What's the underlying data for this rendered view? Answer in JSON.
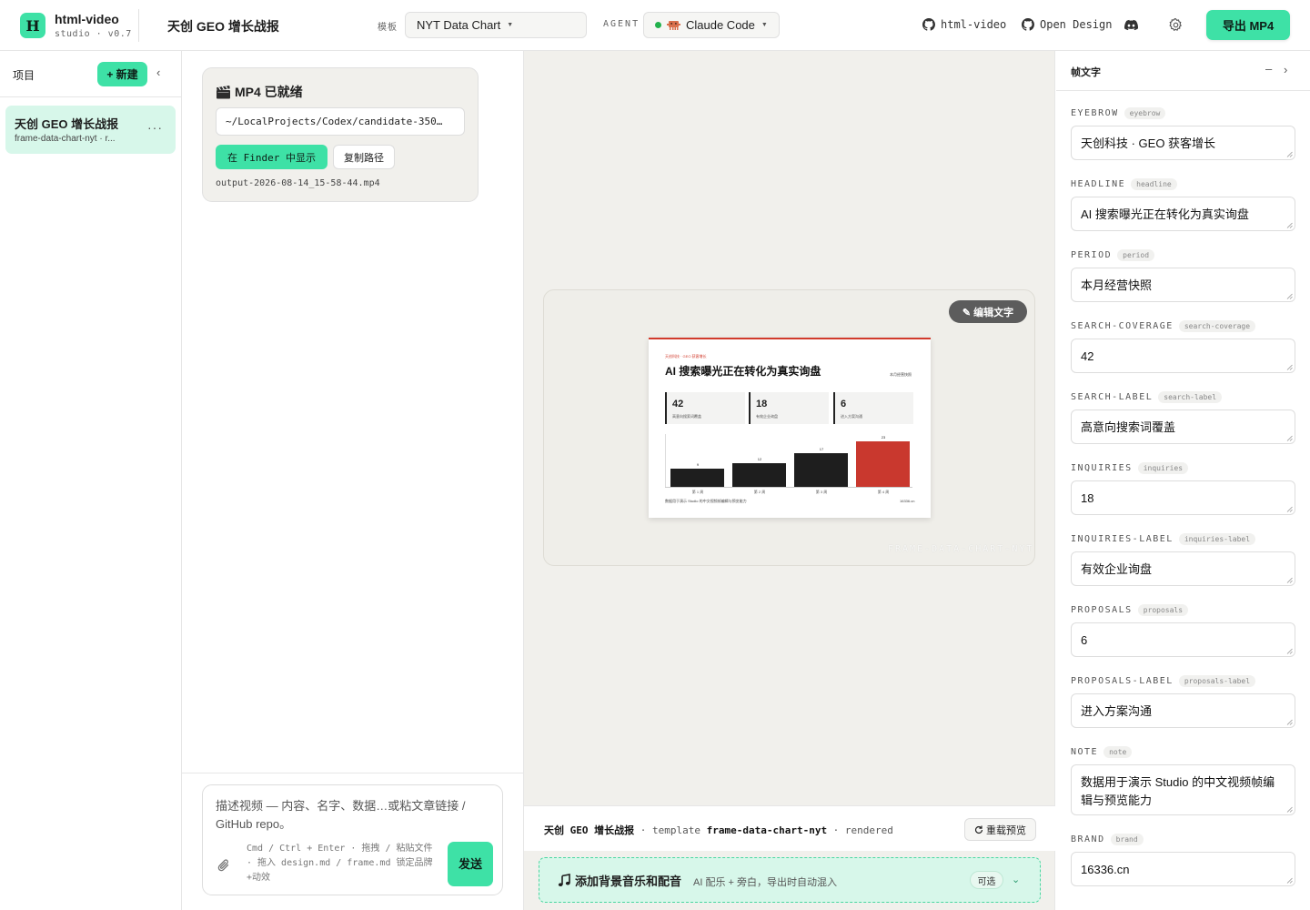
{
  "header": {
    "logo_letter": "H",
    "app_name": "html-video",
    "app_version": "studio · v0.7",
    "project_title": "天创 GEO 增长战报",
    "template_label": "模板",
    "template_value": "NYT Data Chart",
    "agent_label": "AGENT",
    "agent_value": "Claude Code",
    "link_html_video": "html-video",
    "link_open_design": "Open Design",
    "export_label": "导出 MP4",
    "accent_color": "#3ee1a6"
  },
  "sidebar": {
    "title": "项目",
    "new_label": "+ 新建",
    "collapse_glyph": "‹",
    "items": [
      {
        "name": "天创 GEO 增长战报",
        "sub": "frame-data-chart-nyt · r...",
        "more": "···"
      }
    ]
  },
  "chat": {
    "mp4_title": "MP4 已就绪",
    "output_path": "~/LocalProjects/Codex/candidate-350…",
    "finder_label": "在 Finder 中显示",
    "copy_label": "复制路径",
    "output_file": "output-2026-08-14_15-58-44.mp4",
    "composer_placeholder": "描述视频 — 内容、名字、数据…或粘文章链接 / GitHub repo。",
    "composer_hint": "Cmd / Ctrl + Enter · 拖拽 / 粘贴文件 · 拖入 design.md / frame.md 锁定品牌+动效",
    "send_label": "发送"
  },
  "preview": {
    "edit_label": "✎ 编辑文字",
    "watermark": "FRAME-DATA-CHART-NYT",
    "frame": {
      "eyebrow": "天创科技 · GEO 获客增长",
      "headline": "AI 搜索曝光正在转化为真实询盘",
      "period": "本月经营快照",
      "stats": [
        {
          "value": "42",
          "label": "高意向搜索词覆盖"
        },
        {
          "value": "18",
          "label": "有效企业询盘"
        },
        {
          "value": "6",
          "label": "进入方案沟通"
        }
      ],
      "note": "数据用于演示 Studio 的中文视频帧编辑与预览能力",
      "brand": "16336.cn",
      "accent_color": "#d13a2b"
    },
    "chart_data": {
      "type": "bar",
      "categories": [
        "第 1 周",
        "第 2 周",
        "第 3 周",
        "第 4 周"
      ],
      "values": [
        9,
        12,
        17,
        23
      ],
      "highlight_index": 3,
      "ylim": [
        0,
        23
      ],
      "grid": false,
      "colors": {
        "default": "#1e1e1e",
        "highlight": "#c9382e"
      }
    },
    "status": {
      "project": "天创 GEO 增长战报",
      "sep1": " · template ",
      "template": "frame-data-chart-nyt",
      "sep2": " · rendered"
    },
    "reload_label": "重载预览",
    "music_title": "添加背景音乐和配音",
    "music_sub": "AI 配乐 + 旁白，导出时自动混入",
    "optional_label": "可选",
    "music_chevron": "⌄"
  },
  "right": {
    "title": "帧文字",
    "minimize_glyph": "–",
    "next_glyph": "›",
    "fields": [
      {
        "key": "EYEBROW",
        "tag": "eyebrow",
        "value": "天创科技 · GEO 获客增长"
      },
      {
        "key": "HEADLINE",
        "tag": "headline",
        "value": "AI 搜索曝光正在转化为真实询盘"
      },
      {
        "key": "PERIOD",
        "tag": "period",
        "value": "本月经营快照"
      },
      {
        "key": "SEARCH-COVERAGE",
        "tag": "search-coverage",
        "value": "42"
      },
      {
        "key": "SEARCH-LABEL",
        "tag": "search-label",
        "value": "高意向搜索词覆盖"
      },
      {
        "key": "INQUIRIES",
        "tag": "inquiries",
        "value": "18"
      },
      {
        "key": "INQUIRIES-LABEL",
        "tag": "inquiries-label",
        "value": "有效企业询盘"
      },
      {
        "key": "PROPOSALS",
        "tag": "proposals",
        "value": "6"
      },
      {
        "key": "PROPOSALS-LABEL",
        "tag": "proposals-label",
        "value": "进入方案沟通"
      },
      {
        "key": "NOTE",
        "tag": "note",
        "value": "数据用于演示 Studio 的中文视频帧编辑与预览能力"
      },
      {
        "key": "BRAND",
        "tag": "brand",
        "value": "16336.cn"
      }
    ]
  }
}
